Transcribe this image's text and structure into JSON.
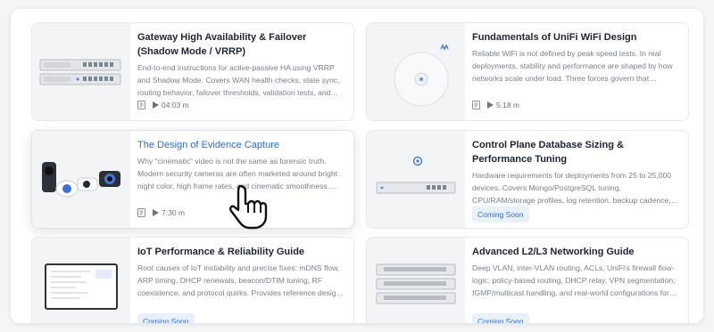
{
  "cards": [
    {
      "title": "Gateway High Availability & Failover (Shadow Mode / VRRP)",
      "description": "End-to-end instructions for active-passive HA using VRRP and Shadow Mode. Covers WAN health checks, state sync, routing behavior, failover thresholds, validation tests, and recommende...",
      "duration": "04:03 m"
    },
    {
      "title": "Fundamentals of UniFi WiFi Design",
      "description": "Reliable WiFi is not defined by peak speed tests. In real deployments, stability and performance are shaped by how networks scale under load. Three forces govern that behavior:...",
      "duration": "5:18 m"
    },
    {
      "title": "The Design of Evidence Capture",
      "description": "Why \"cinematic\" video is not the same as forensic truth. Modern security cameras are often marketed around bright night color, high frame rates, and cinematic smoothness. While these...",
      "duration": "7:30 m"
    },
    {
      "title": "Control Plane Database Sizing & Performance Tuning",
      "description": "Hardware requirements for deployments from 25 to 25,000 devices. Covers Mongo/PostgreSQL tuning, CPU/RAM/storage profiles, log retention, backup cadence, and monitoring...",
      "badge": "Coming Soon"
    },
    {
      "title": "IoT Performance & Reliability Guide",
      "description": "Root causes of IoT instability and precise fixes: mDNS flow, ARP timing, DHCP renewals, beacon/DTIM tuning, RF coexistence, and protocol quirks. Provides reference designs for lighting,...",
      "badge": "Coming Soon"
    },
    {
      "title": "Advanced L2/L3 Networking Guide",
      "description": "Deep VLAN, inter-VLAN routing, ACLs, UniFi's firewall flow-logic, policy-based routing, DHCP relay, VPN segmentation, IGMP/multicast handling, and real-world configurations for VoIP...",
      "badge": "Coming Soon"
    }
  ],
  "colors": {
    "link": "#2a6ed8",
    "badge_bg": "#e8f0fc",
    "badge_text": "#3470d6"
  }
}
